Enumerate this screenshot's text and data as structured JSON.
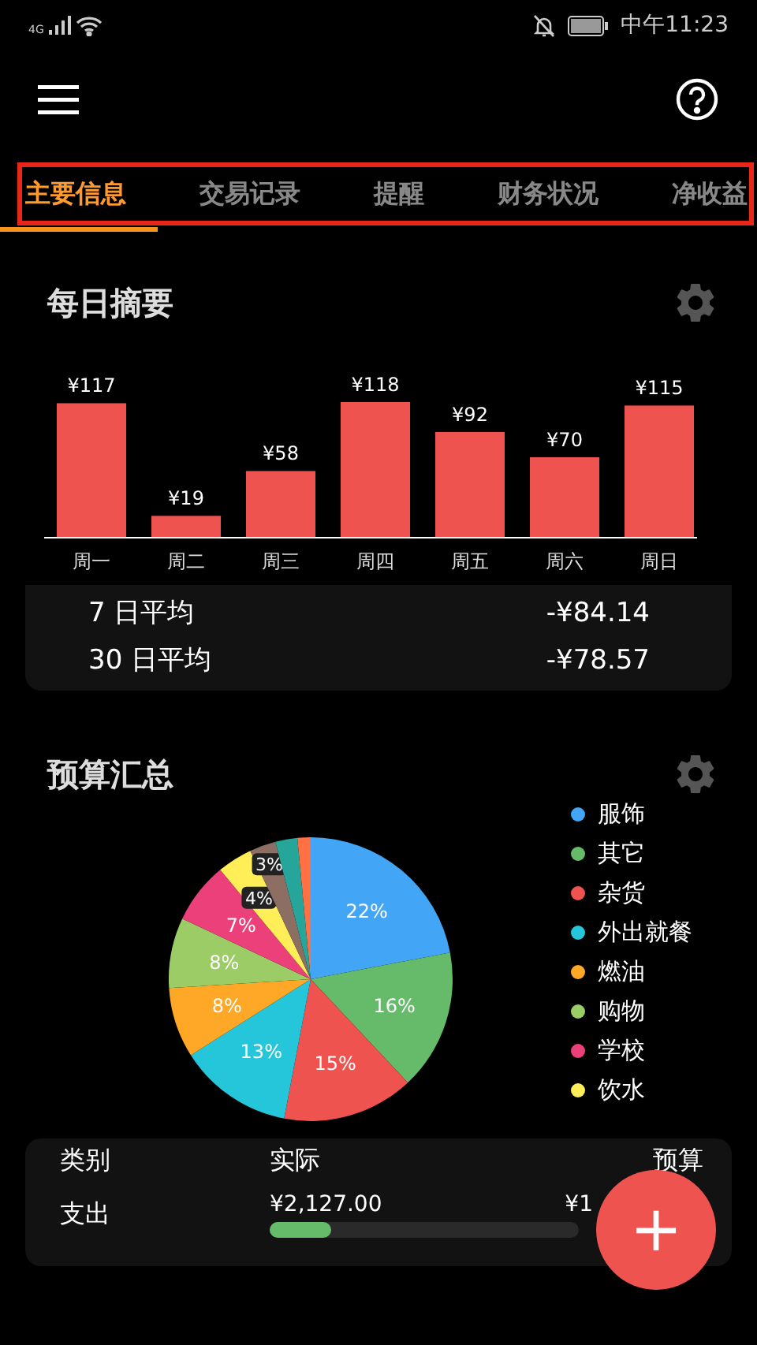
{
  "status_bar": {
    "network": "4G",
    "time": "中午11:23"
  },
  "tabs": [
    {
      "label": "主要信息",
      "selected": true
    },
    {
      "label": "交易记录",
      "selected": false
    },
    {
      "label": "提醒",
      "selected": false
    },
    {
      "label": "财务状况",
      "selected": false
    },
    {
      "label": "净收益",
      "selected": false
    }
  ],
  "daily_summary": {
    "title": "每日摘要",
    "chart_data": {
      "type": "bar",
      "categories": [
        "周一",
        "周二",
        "周三",
        "周四",
        "周五",
        "周六",
        "周日"
      ],
      "values": [
        117,
        19,
        58,
        118,
        92,
        70,
        115
      ],
      "value_labels": [
        "¥117",
        "¥19",
        "¥58",
        "¥118",
        "¥92",
        "¥70",
        "¥115"
      ],
      "color": "#ef5350"
    },
    "averages": [
      {
        "label": "7 日平均",
        "value": "-¥84.14"
      },
      {
        "label": "30 日平均",
        "value": "-¥78.57"
      }
    ]
  },
  "budget_summary": {
    "title": "预算汇总",
    "chart_data": {
      "type": "pie",
      "values": [
        22,
        16,
        15,
        13,
        8,
        8,
        7,
        4,
        3,
        2.5,
        1.5
      ],
      "value_labels": [
        "22%",
        "16%",
        "15%",
        "13%",
        "8%",
        "8%",
        "7%",
        "4%",
        "3%",
        null,
        null
      ],
      "colors": [
        "#42a5f5",
        "#66bb6a",
        "#ef5350",
        "#26c6da",
        "#ffa726",
        "#9ccc65",
        "#ec407a",
        "#ffee58",
        "#8d6e63",
        "#26a69a",
        "#ff7043"
      ]
    },
    "legend": [
      {
        "label": "服饰",
        "color": "#42a5f5"
      },
      {
        "label": "其它",
        "color": "#66bb6a"
      },
      {
        "label": "杂货",
        "color": "#ef5350"
      },
      {
        "label": "外出就餐",
        "color": "#26c6da"
      },
      {
        "label": "燃油",
        "color": "#ffa726"
      },
      {
        "label": "购物",
        "color": "#9ccc65"
      },
      {
        "label": "学校",
        "color": "#ec407a"
      },
      {
        "label": "饮水",
        "color": "#ffee58"
      }
    ],
    "table": {
      "columns": [
        "类别",
        "实际",
        "预算"
      ],
      "rows": [
        {
          "category": "支出",
          "actual": "¥2,127.00",
          "budget": "¥1",
          "level": 0.2
        }
      ]
    }
  },
  "fab": {
    "label": "+"
  }
}
